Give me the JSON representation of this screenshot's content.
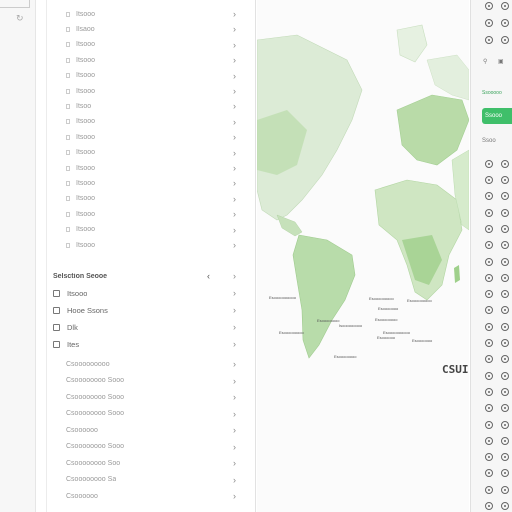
{
  "rail": {
    "glyph": "↻"
  },
  "tree": {
    "top_items": [
      {
        "label": "Itsooo"
      },
      {
        "label": "Ilsaoo"
      },
      {
        "label": "Itsooo"
      },
      {
        "label": "Itsooo"
      },
      {
        "label": "Itsooo"
      },
      {
        "label": "Itsooo"
      },
      {
        "label": "Itsoo"
      },
      {
        "label": "Itsooo"
      },
      {
        "label": "Itsooo"
      },
      {
        "label": "Itsooo"
      },
      {
        "label": "Itsooo"
      },
      {
        "label": "Itsooo"
      },
      {
        "label": "Itsooo"
      },
      {
        "label": "Itsooo"
      },
      {
        "label": "Itsooo"
      },
      {
        "label": "Itsooo"
      }
    ],
    "section_title": "Selsction Seooe",
    "groups": [
      {
        "label": "Itsooo"
      },
      {
        "label": "Hooe Ssons"
      },
      {
        "label": "Dlk"
      },
      {
        "label": "Ites"
      }
    ],
    "sub_items": [
      {
        "label": "Csooooooooo"
      },
      {
        "label": "Csoooooooo Sooo"
      },
      {
        "label": "Csoooooooo Sooo"
      },
      {
        "label": "Csoooooooo Sooo"
      },
      {
        "label": "Csoooooo"
      },
      {
        "label": "Csoooooooo Sooo"
      },
      {
        "label": "Csoooooooo Soo"
      },
      {
        "label": "Csoooooooo Sa"
      },
      {
        "label": "Csoooooo"
      }
    ]
  },
  "map": {
    "labels": [
      {
        "text": "Esoooooooooo"
      },
      {
        "text": "Esoooooooo"
      },
      {
        "text": "Isooooooooo"
      },
      {
        "text": "Esooooooooo"
      },
      {
        "text": "Esoooooooo"
      },
      {
        "text": "Esooooooooo"
      },
      {
        "text": "Esooooooooo"
      },
      {
        "text": "Esooooooo"
      },
      {
        "text": "Esoooooooooo"
      },
      {
        "text": "Esoooooooo"
      },
      {
        "text": "Esoooooo"
      },
      {
        "text": "Esooooooo"
      }
    ],
    "zoom_text": "CSUI",
    "colors": {
      "land": "#cfe8c4",
      "land_dark": "#a9d69b",
      "water": "#fbfbfb"
    }
  },
  "strip": {
    "green_text": "Ssooooo",
    "button_label": "Ssooo",
    "small_label": "Ssoo",
    "icon_name": "settings-icon",
    "accent": "#3fbf6a"
  }
}
